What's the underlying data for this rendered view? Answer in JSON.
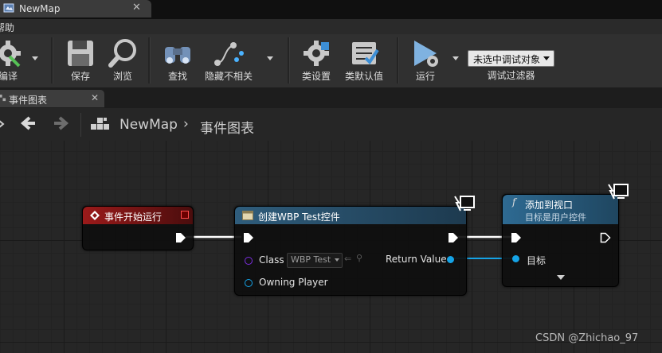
{
  "window": {
    "tab_title": "NewMap"
  },
  "menu": {
    "help": "帮助"
  },
  "toolbar": {
    "compile": "编译",
    "save": "保存",
    "browse": "浏览",
    "find": "查找",
    "hide_unrelated": "隐藏不相关",
    "class_settings": "类设置",
    "class_defaults": "类默认值",
    "play": "运行",
    "debug_object": "未选中调试对象",
    "debug_filter": "调试过滤器"
  },
  "graph_tab": {
    "title": "事件图表"
  },
  "breadcrumb": {
    "map": "NewMap",
    "graph": "事件图表"
  },
  "nodes": {
    "begin_play": {
      "title": "事件开始运行"
    },
    "create_widget": {
      "title": "创建WBP Test控件",
      "class_label": "Class",
      "class_value": "WBP Test",
      "owning_player": "Owning Player",
      "return_value": "Return Value"
    },
    "add_to_viewport": {
      "function_glyph": "f",
      "title": "添加到视口",
      "subtitle": "目标是用户控件",
      "target": "目标"
    }
  },
  "colors": {
    "event_header": "#8c1616",
    "function_header": "#2e5f80",
    "object_pin": "#15a3e6",
    "class_pin": "#6a25c7",
    "exec_wire": "#ffffff"
  },
  "watermark": "CSDN @Zhichao_97"
}
